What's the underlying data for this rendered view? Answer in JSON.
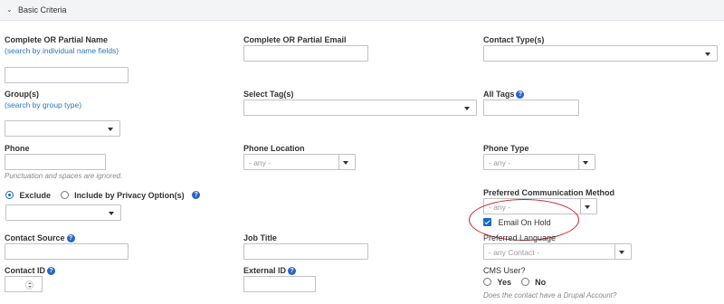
{
  "section": {
    "title": "Basic Criteria"
  },
  "name": {
    "label": "Complete OR Partial Name",
    "link": "(search by individual name fields)"
  },
  "email": {
    "label": "Complete OR Partial Email"
  },
  "contact_type": {
    "label": "Contact Type(s)"
  },
  "group": {
    "label": "Group(s)",
    "link": "(search by group type)"
  },
  "tags": {
    "label": "Select Tag(s)"
  },
  "all_tags": {
    "label": "All Tags"
  },
  "phone": {
    "label": "Phone",
    "note": "Punctuation and spaces are ignored."
  },
  "phone_location": {
    "label": "Phone Location",
    "value": "- any -"
  },
  "phone_type": {
    "label": "Phone Type",
    "value": "- any -"
  },
  "privacy": {
    "exclude": "Exclude",
    "include": "Include by Privacy Option(s)"
  },
  "pref_comm": {
    "label": "Preferred Communication Method",
    "value": "- any -"
  },
  "email_hold": {
    "label": "Email On Hold"
  },
  "contact_source": {
    "label": "Contact Source"
  },
  "job_title": {
    "label": "Job Title"
  },
  "pref_lang": {
    "label": "Preferred Language",
    "value": "- any Contact -"
  },
  "contact_id": {
    "label": "Contact ID"
  },
  "external_id": {
    "label": "External ID"
  },
  "cms_user": {
    "label": "CMS User?",
    "yes": "Yes",
    "no": "No",
    "note": "Does the contact have a Drupal Account?"
  },
  "help_glyph": "?",
  "chevron_glyph": "⌄"
}
